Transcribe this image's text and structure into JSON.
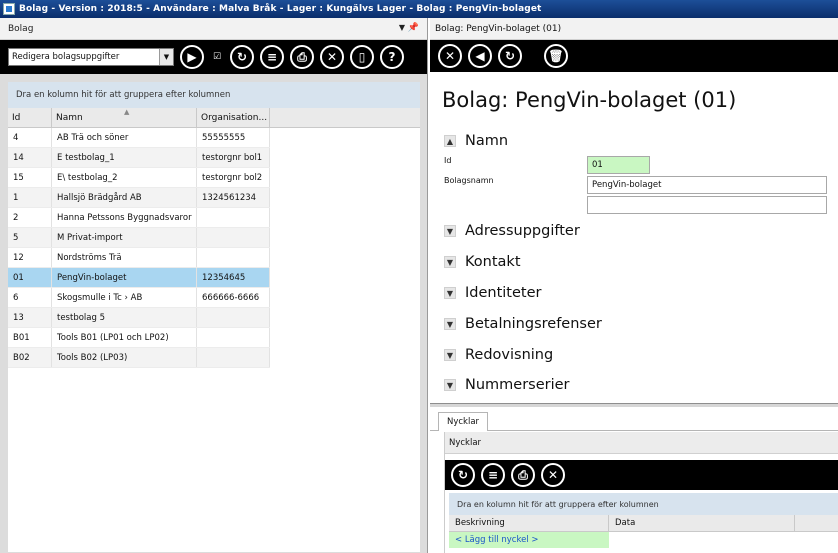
{
  "window": {
    "title": "Bolag - Version : 2018:5 - Användare : Malva Bråk - Lager : Kungälvs Lager - Bolag : PengVin-bolaget"
  },
  "left": {
    "header": "Bolag",
    "combo_value": "Redigera bolagsuppgifter",
    "group_hint": "Dra en kolumn hit för att gruppera efter kolumnen",
    "columns": {
      "id": "Id",
      "namn": "Namn",
      "org": "Organisation..."
    },
    "rows": [
      {
        "id": "4",
        "namn": "AB Trä och söner",
        "org": "55555555"
      },
      {
        "id": "14",
        "namn": "E      testbolag_1",
        "org": "testorgnr bol1"
      },
      {
        "id": "15",
        "namn": "E\\      testbolag_2",
        "org": "testorgnr bol2"
      },
      {
        "id": "1",
        "namn": "Hallsjö Brädgård  AB",
        "org": "1324561234"
      },
      {
        "id": "2",
        "namn": "Hanna Petssons Byggnadsvaror",
        "org": ""
      },
      {
        "id": "5",
        "namn": "M      Privat-import",
        "org": ""
      },
      {
        "id": "12",
        "namn": "Nordströms Trä",
        "org": ""
      },
      {
        "id": "01",
        "namn": "PengVin-bolaget",
        "org": "12354645"
      },
      {
        "id": "6",
        "namn": "Skogsmulle i Tc        › AB",
        "org": "666666-6666"
      },
      {
        "id": "13",
        "namn": "testbolag 5",
        "org": ""
      },
      {
        "id": "B01",
        "namn": "Tools B01 (LP01 och LP02)",
        "org": ""
      },
      {
        "id": "B02",
        "namn": "Tools B02 (LP03)",
        "org": ""
      }
    ],
    "selected_row_index": 7
  },
  "right": {
    "header": "Bolag: PengVin-bolaget (01)",
    "page_title": "Bolag: PengVin-bolaget (01)",
    "sections": {
      "namn": "Namn",
      "adress": "Adressuppgifter",
      "kontakt": "Kontakt",
      "identiteter": "Identiteter",
      "betalning": "Betalningsrefenser",
      "redovisning": "Redovisning",
      "nummerserier": "Nummerserier"
    },
    "fields": {
      "id_label": "Id",
      "id_value": "01",
      "namn_label": "Bolagsnamn",
      "namn_value": "PengVin-bolaget",
      "namn_value2": ""
    },
    "tab_label": "Nycklar",
    "sub_header": "Nycklar",
    "sub_hint": "Dra en kolumn hit för att gruppera efter kolumnen",
    "sub_columns": {
      "beskrivning": "Beskrivning",
      "data": "Data"
    },
    "add_row": "< Lägg till nyckel >"
  },
  "icons": {
    "colors": {
      "selected_row": "#a9d6f1",
      "required_field": "#c9f7c2",
      "toolbar": "#000000"
    }
  }
}
